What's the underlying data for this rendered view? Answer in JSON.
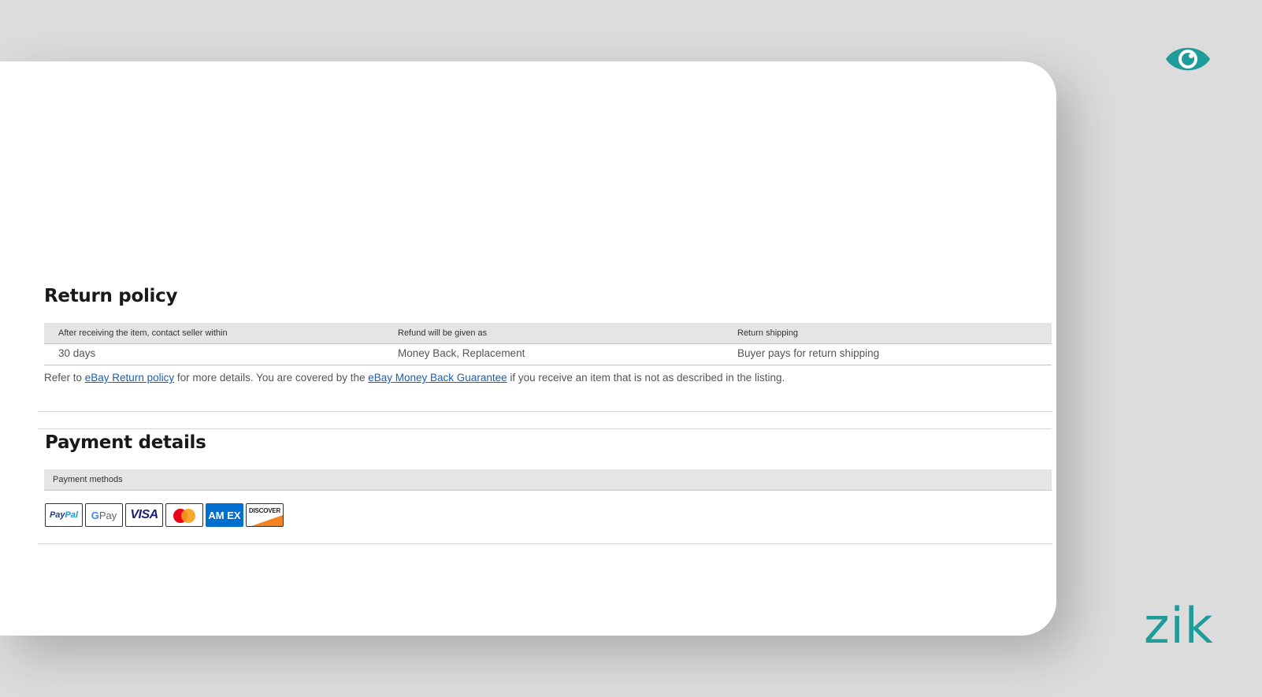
{
  "colors": {
    "background": "#dcdcdc",
    "card": "#ffffff",
    "brand_teal": "#1e9c9a",
    "link": "#1a5fb4",
    "table_header": "#e5e5e5"
  },
  "brand": {
    "eye_icon": "eye-icon",
    "wordmark": "zik"
  },
  "return_policy": {
    "title": "Return policy",
    "headers": [
      "After receiving the item, contact seller within",
      "Refund will be given as",
      "Return shipping"
    ],
    "values": [
      "30 days",
      "Money Back, Replacement",
      "Buyer pays for return shipping"
    ],
    "note": {
      "prefix": "Refer to ",
      "link1": "eBay Return policy",
      "middle": " for more details. You are covered by the ",
      "link2": "eBay Money Back Guarantee",
      "suffix": " if you receive an item that is not as described in the listing."
    }
  },
  "payment_details": {
    "title": "Payment details",
    "header": "Payment methods",
    "methods": {
      "paypal_a": "Pay",
      "paypal_b": "Pal",
      "gpay_g": "G",
      "gpay_text": " Pay",
      "visa": "VISA",
      "mastercard": "mastercard-icon",
      "amex": "AM EX",
      "discover": "DISCOVER"
    }
  }
}
